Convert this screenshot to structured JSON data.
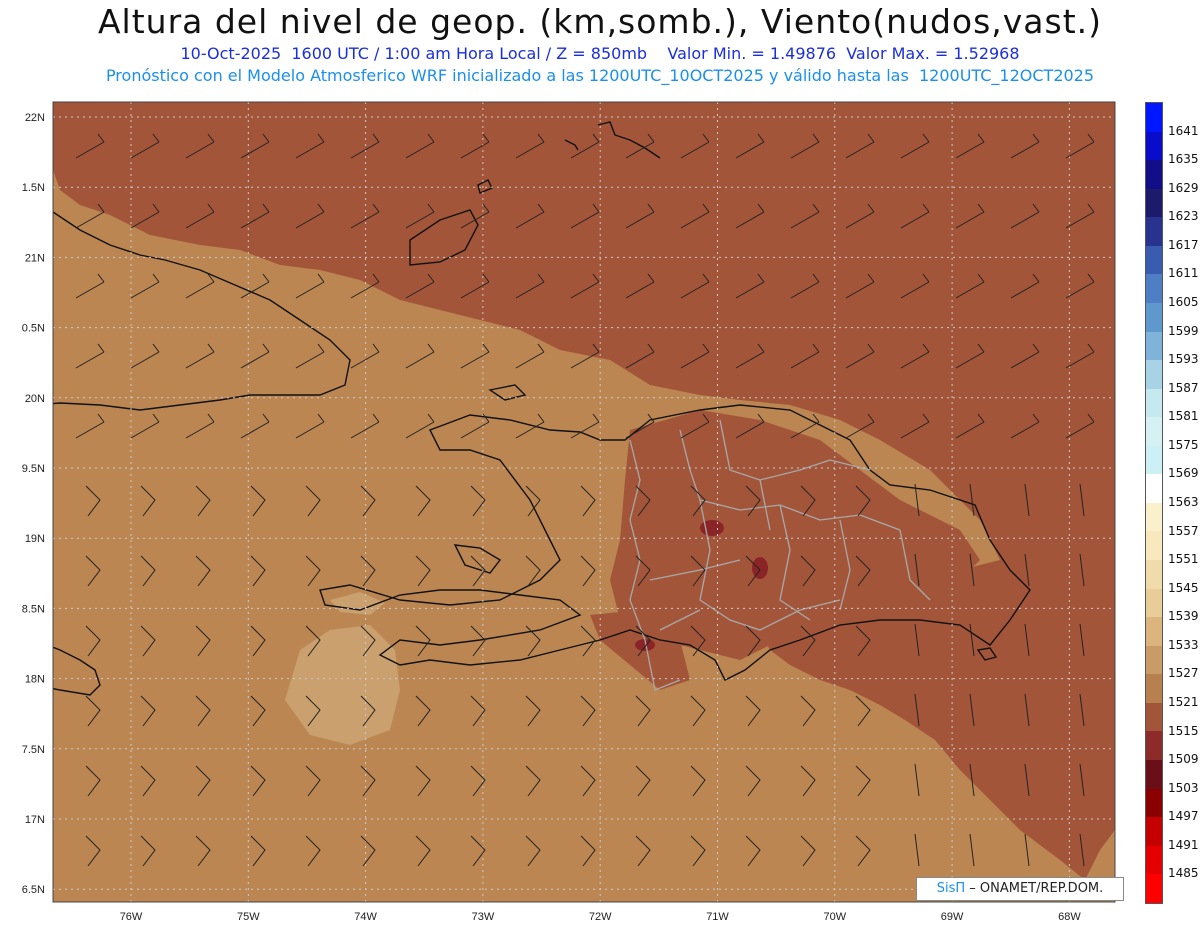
{
  "header": {
    "title": "Altura del nivel de geop. (km,somb.), Viento(nudos,vast.)",
    "line1": "10-Oct-2025  1600 UTC / 1:00 am Hora Local / Z = 850mb    Valor Min. = 1.49876  Valor Max. = 1.52968",
    "line2": "Pronóstico con el Modelo Atmosferico WRF inicializado a las 1200UTC_10OCT2025 y válido hasta las  1200UTC_12OCT2025"
  },
  "axes": {
    "lat_labels": [
      "22N",
      "1.5N",
      "21N",
      "0.5N",
      "20N",
      "9.5N",
      "19N",
      "8.5N",
      "18N",
      "7.5N",
      "17N",
      "6.5N"
    ],
    "lon_labels": [
      "76W",
      "75W",
      "74W",
      "73W",
      "72W",
      "71W",
      "70W",
      "69W",
      "68W"
    ]
  },
  "colorbar": {
    "labels": [
      "1641",
      "1635",
      "1629",
      "1623",
      "1617",
      "1611",
      "1605",
      "1599",
      "1593",
      "1587",
      "1581",
      "1575",
      "1569",
      "1563",
      "1557",
      "1551",
      "1545",
      "1539",
      "1533",
      "1527",
      "1521",
      "1515",
      "1509",
      "1503",
      "1497",
      "1491",
      "1485"
    ],
    "colors": [
      "#0016ff",
      "#0a0ccc",
      "#120e88",
      "#1c1a6a",
      "#27338f",
      "#3a5cb0",
      "#4e7fc4",
      "#5f98cc",
      "#7fb3d9",
      "#a8d3e6",
      "#c6e9ef",
      "#d6f1f4",
      "#cdf0f7",
      "#ffffff",
      "#fbf0cc",
      "#f7e8bd",
      "#f0dcab",
      "#e9cd98",
      "#dcb47e",
      "#c99b66",
      "#b9804f",
      "#a3553a",
      "#8d2b2b",
      "#6a0f18",
      "#8a0000",
      "#c40000",
      "#e40000",
      "#ff0000"
    ],
    "shown_field_colors": {
      "high": "#a3553a",
      "mid": "#bb8652",
      "low": "#c9a06e",
      "dark": "#8a2427"
    }
  },
  "credit": {
    "brand": "SisΠ",
    "rest": " – ONAMET/REP.DOM."
  }
}
